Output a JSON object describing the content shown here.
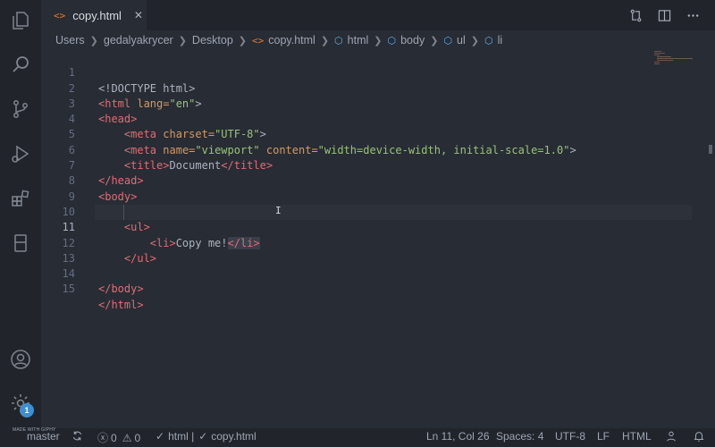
{
  "tab": {
    "label": "copy.html",
    "file_icon": "<>",
    "close": "✕"
  },
  "breadcrumb": {
    "items": [
      "Users",
      "gedalyakrycer",
      "Desktop",
      "copy.html",
      "html",
      "body",
      "ul",
      "li"
    ]
  },
  "editor": {
    "lines": [
      {
        "n": "1"
      },
      {
        "n": "2"
      },
      {
        "n": "3"
      },
      {
        "n": "4"
      },
      {
        "n": "5"
      },
      {
        "n": "6"
      },
      {
        "n": "7"
      },
      {
        "n": "8"
      },
      {
        "n": "9"
      },
      {
        "n": "10"
      },
      {
        "n": "11"
      },
      {
        "n": "12"
      },
      {
        "n": "13"
      },
      {
        "n": "14"
      },
      {
        "n": "15"
      }
    ],
    "tokens": {
      "doctype": "<!DOCTYPE html>",
      "html_open": "<html",
      "lang_attr": "lang=",
      "lang_val": "\"en\"",
      "close_bracket": ">",
      "head": "<head>",
      "meta": "<meta",
      "charset_attr": "charset=",
      "charset_val": "\"UTF-8\"",
      "name_attr": "name=",
      "name_val": "\"viewport\"",
      "content_attr": "content=",
      "content_val": "\"width=device-width, initial-scale=1.0\"",
      "title_open": "<title>",
      "title_text": "Document",
      "title_close": "</title>",
      "head_close": "</head>",
      "body_open": "<body>",
      "ul_open": "<ul>",
      "li_open": "<li>",
      "li_text": "Copy me!",
      "li_close": "</li>",
      "ul_close": "</ul>",
      "body_close": "</body>",
      "html_close": "</html>"
    }
  },
  "status": {
    "branch": "master",
    "errors": "0",
    "warnings": "0",
    "check1": "html |",
    "check2": "copy.html",
    "position": "Ln 11, Col 26",
    "spaces": "Spaces: 4",
    "encoding": "UTF-8",
    "eol": "LF",
    "language": "HTML",
    "badge_count": "1",
    "watermark": "MADE WITH GIPHY"
  },
  "colors": {
    "accent": "#3e8ed0",
    "tag": "#e06c75",
    "attr": "#d19a66",
    "string": "#98c379"
  }
}
